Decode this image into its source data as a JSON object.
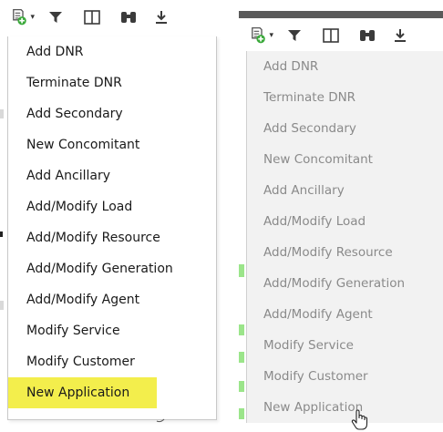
{
  "left_menu": {
    "items": [
      "Add DNR",
      "Terminate DNR",
      "Add Secondary",
      "New Concomitant",
      "Add Ancillary",
      "Add/Modify Load",
      "Add/Modify Resource",
      "Add/Modify Generation",
      "Add/Modify Agent",
      "Modify Service",
      "Modify Customer",
      "New Application"
    ],
    "highlighted": "New Application",
    "highlight_color": "#f3ee4c"
  },
  "right_menu": {
    "items": [
      "Add DNR",
      "Terminate DNR",
      "Add Secondary",
      "New Concomitant",
      "Add Ancillary",
      "Add/Modify Load",
      "Add/Modify Resource",
      "Add/Modify Generation",
      "Add/Modify Agent",
      "Modify Service",
      "Modify Customer",
      "New Application"
    ],
    "text_color": "#8a8a8a"
  },
  "toolbar_icons": [
    "add-document-icon",
    "filter-icon",
    "columns-icon",
    "binoculars-icon",
    "download-icon"
  ]
}
